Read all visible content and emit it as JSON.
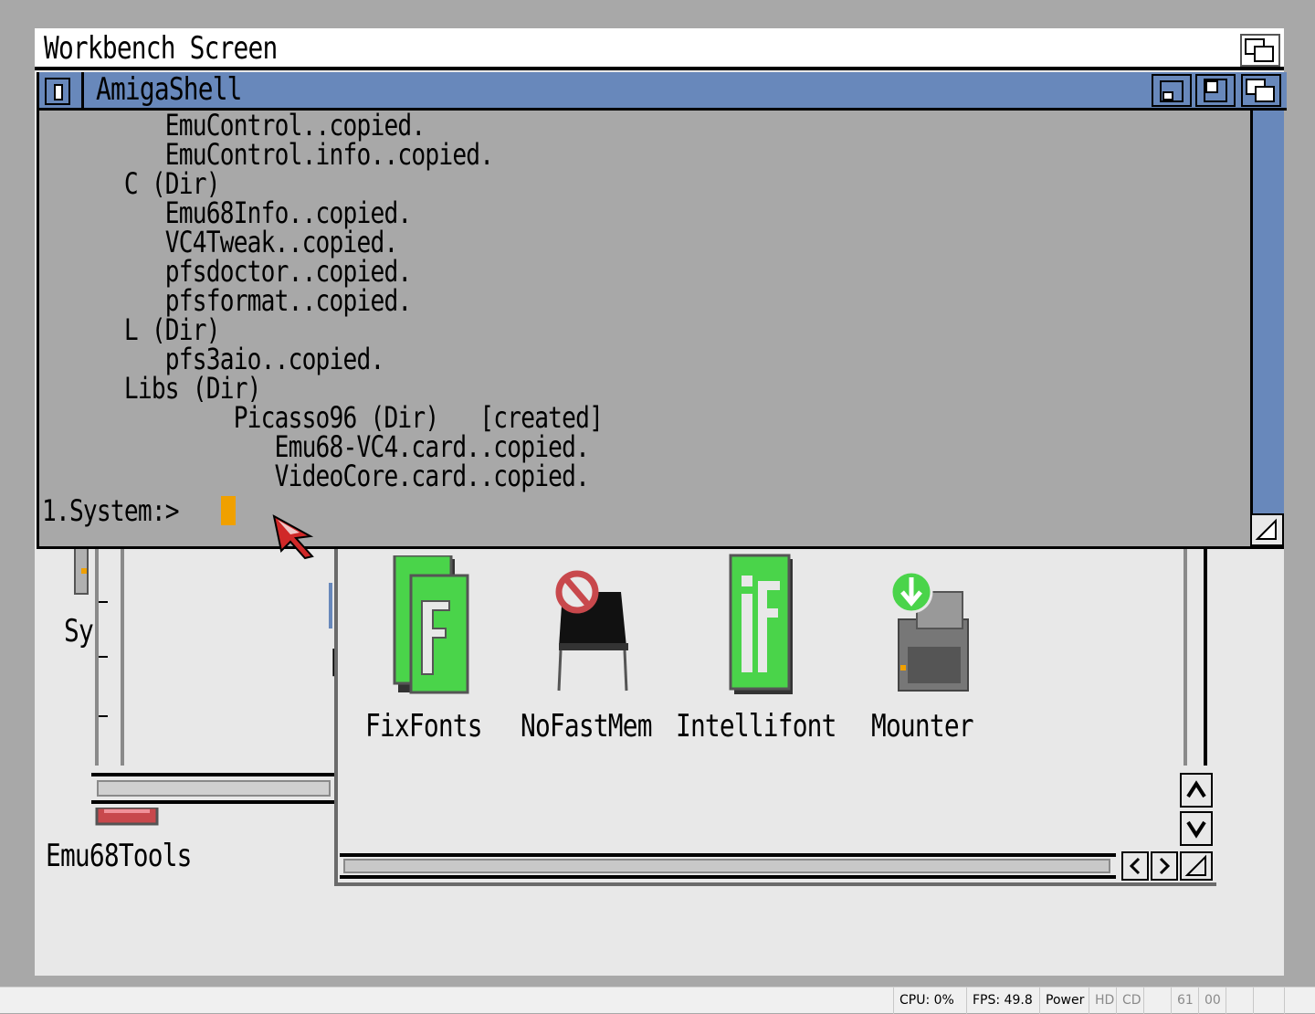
{
  "screen": {
    "title": "Workbench Screen"
  },
  "shell": {
    "title": "AmigaShell",
    "lines": [
      "         EmuControl..copied.",
      "         EmuControl.info..copied.",
      "      C (Dir)",
      "         Emu68Info..copied.",
      "         VC4Tweak..copied.",
      "         pfsdoctor..copied.",
      "         pfsformat..copied.",
      "      L (Dir)",
      "         pfs3aio..copied.",
      "      Libs (Dir)",
      "              Picasso96 (Dir)   [created]",
      "                 Emu68-VC4.card..copied.",
      "                 VideoCore.card..copied."
    ],
    "prompt": "1.System:> "
  },
  "left_window": {
    "truncated_label": "Sy",
    "drawer_label": "Emu68Tools"
  },
  "drawer": {
    "icons": [
      {
        "label": "FixFonts",
        "icon": "fixfonts-icon"
      },
      {
        "label": "NoFastMem",
        "icon": "nofastmem-icon"
      },
      {
        "label": "Intellifont",
        "icon": "intellifont-icon"
      },
      {
        "label": "Mounter",
        "icon": "mounter-icon"
      }
    ]
  },
  "statusbar": {
    "cpu": "CPU: 0%",
    "fps": "FPS: 49.8",
    "power": "Power",
    "hd": "HD",
    "cd": "CD",
    "df0": "61",
    "df1": "00"
  },
  "colors": {
    "title_blue": "#6888bb",
    "cursor_orange": "#f0a000",
    "icon_green": "#4ad44a"
  }
}
